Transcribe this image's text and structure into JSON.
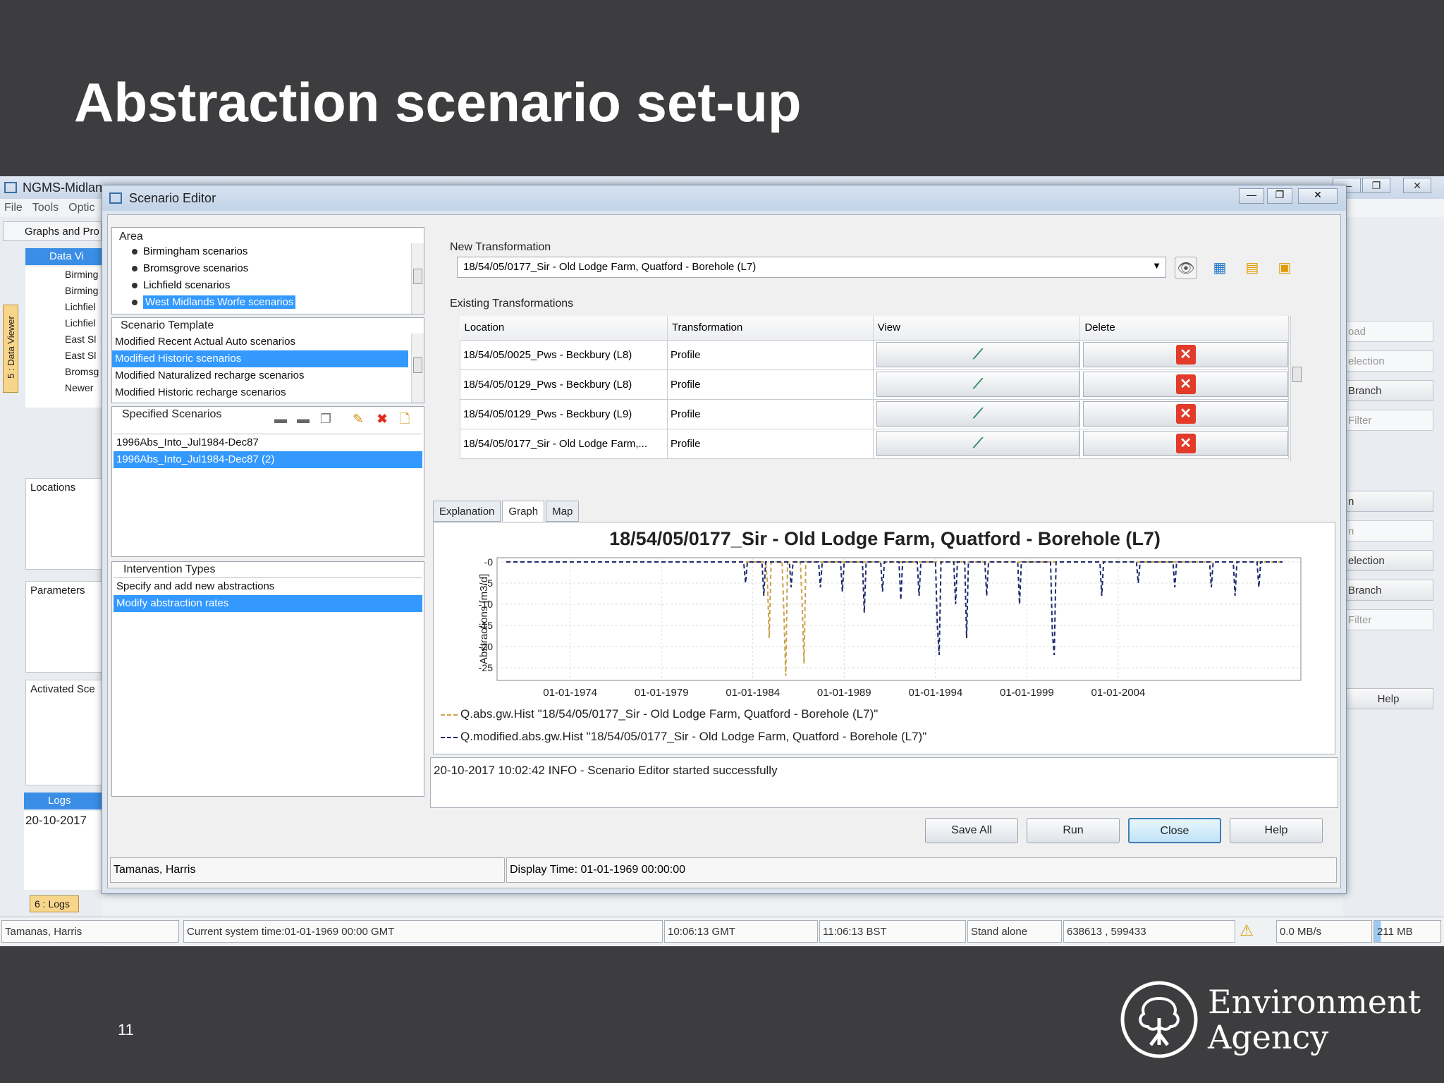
{
  "slide": {
    "title": "Abstraction scenario set-up",
    "page_number": "11",
    "logo_line1": "Environment",
    "logo_line2": "Agency"
  },
  "app": {
    "title": "NGMS-Midlan",
    "menu": [
      "File",
      "Tools",
      "Optic"
    ],
    "graphs_tab": "Graphs and Pro",
    "data_viewer_title": "Data Vi",
    "side_tab": "5 : Data Viewer",
    "tree_items": [
      "Birming",
      "Birming",
      "Lichfiel",
      "Lichfiel",
      "East Sl",
      "East Sl",
      "Bromsg",
      "Newer"
    ],
    "locations_label": "Locations",
    "parameters_label": "Parameters",
    "activated_label": "Activated Sce",
    "logs_title": "Logs",
    "logs_date": "20-10-2017",
    "logs_tab": "6 : Logs",
    "right_buttons": [
      "oad",
      "election",
      "Branch",
      "Filter",
      "n",
      "n",
      "election",
      "Branch",
      "Filter",
      "Help"
    ]
  },
  "statusbar": {
    "user": "Tamanas, Harris",
    "system_time": "Current system time:01-01-1969 00:00 GMT",
    "gmt": "10:06:13 GMT",
    "bst": "11:06:13 BST",
    "mode": "Stand alone",
    "coords": "638613 , 599433",
    "rate": "0.0 MB/s",
    "memory": "211 MB"
  },
  "dialog": {
    "title": "Scenario Editor",
    "area_label": "Area",
    "areas": [
      "Birmingham scenarios",
      "Bromsgrove scenarios",
      "Lichfield scenarios",
      "West Midlands Worfe scenarios"
    ],
    "template_label": "Scenario Template",
    "templates": [
      "Modified Recent Actual Auto scenarios",
      "Modified Historic scenarios",
      "Modified Naturalized recharge scenarios",
      "Modified Historic recharge scenarios"
    ],
    "specified_label": "Specified Scenarios",
    "specified": [
      "1996Abs_Into_Jul1984-Dec87",
      "1996Abs_Into_Jul1984-Dec87 (2)"
    ],
    "intervention_label": "Intervention Types",
    "interventions": [
      "Specify and add new abstractions",
      "Modify abstraction rates"
    ],
    "new_transformation_label": "New Transformation",
    "new_transformation_value": "18/54/05/0177_Sir - Old Lodge Farm, Quatford - Borehole (L7)",
    "existing_label": "Existing Transformations",
    "columns": [
      "Location",
      "Transformation",
      "View",
      "Delete"
    ],
    "rows": [
      {
        "location": "18/54/05/0025_Pws - Beckbury (L8)",
        "transformation": "Profile"
      },
      {
        "location": "18/54/05/0129_Pws - Beckbury (L8)",
        "transformation": "Profile"
      },
      {
        "location": "18/54/05/0129_Pws - Beckbury (L9)",
        "transformation": "Profile"
      },
      {
        "location": "18/54/05/0177_Sir - Old Lodge Farm,...",
        "transformation": "Profile"
      }
    ],
    "tabs": [
      "Explanation",
      "Graph",
      "Map"
    ],
    "log_message": "20-10-2017 10:02:42 INFO - Scenario Editor started successfully",
    "buttons": [
      "Save All",
      "Run",
      "Close",
      "Help"
    ],
    "status_user": "Tamanas, Harris",
    "status_time": "Display Time: 01-01-1969 00:00:00"
  },
  "chart_data": {
    "type": "line",
    "title": "18/54/05/0177_Sir - Old Lodge Farm, Quatford - Borehole (L7)",
    "ylabel": "Abstractions [m3/d]",
    "xlabel": "",
    "x_ticks": [
      "01-01-1974",
      "01-01-1979",
      "01-01-1984",
      "01-01-1989",
      "01-01-1994",
      "01-01-1999",
      "01-01-2004"
    ],
    "y_ticks": [
      "-0",
      "-5",
      "-10",
      "-15",
      "-20",
      "-25"
    ],
    "ylim": [
      -28,
      1
    ],
    "xlim": [
      1970,
      2014
    ],
    "grid": true,
    "colors": {
      "hist": "#c9a34a",
      "modified": "#1f2a6e"
    },
    "series": [
      {
        "name": "Q.abs.gw.Hist \"18/54/05/0177_Sir - Old Lodge Farm, Quatford - Borehole (L7)\"",
        "points": [
          [
            1970.5,
            0
          ],
          [
            1984.7,
            0
          ],
          [
            1984.8,
            -5
          ],
          [
            1984.9,
            -18
          ],
          [
            1985.0,
            0
          ],
          [
            1985.6,
            0
          ],
          [
            1985.7,
            -12
          ],
          [
            1985.8,
            -27
          ],
          [
            1985.9,
            0
          ],
          [
            1986.6,
            0
          ],
          [
            1986.7,
            -10
          ],
          [
            1986.8,
            -24
          ],
          [
            1986.9,
            0
          ],
          [
            2013.0,
            0
          ]
        ]
      },
      {
        "name": "Q.modified.abs.gw.Hist \"18/54/05/0177_Sir - Old Lodge Farm, Quatford - Borehole (L7)\"",
        "points": [
          [
            1970.5,
            0
          ],
          [
            1983.5,
            0
          ],
          [
            1983.6,
            -5
          ],
          [
            1983.7,
            0
          ],
          [
            1984.5,
            0
          ],
          [
            1984.6,
            -8
          ],
          [
            1984.7,
            0
          ],
          [
            1986.0,
            0
          ],
          [
            1986.1,
            -6
          ],
          [
            1986.2,
            0
          ],
          [
            1987.6,
            0
          ],
          [
            1987.7,
            -6
          ],
          [
            1987.8,
            0
          ],
          [
            1988.8,
            0
          ],
          [
            1988.9,
            -7
          ],
          [
            1989.0,
            0
          ],
          [
            1990.0,
            0
          ],
          [
            1990.1,
            -12
          ],
          [
            1990.2,
            0
          ],
          [
            1991.0,
            0
          ],
          [
            1991.1,
            -7
          ],
          [
            1991.2,
            0
          ],
          [
            1992.0,
            0
          ],
          [
            1992.1,
            -9
          ],
          [
            1992.2,
            0
          ],
          [
            1993.0,
            0
          ],
          [
            1993.1,
            -8
          ],
          [
            1993.2,
            0
          ],
          [
            1994.0,
            0
          ],
          [
            1994.1,
            -15
          ],
          [
            1994.2,
            -22
          ],
          [
            1994.3,
            0
          ],
          [
            1995.0,
            0
          ],
          [
            1995.1,
            -10
          ],
          [
            1995.2,
            0
          ],
          [
            1995.6,
            0
          ],
          [
            1995.7,
            -18
          ],
          [
            1995.8,
            0
          ],
          [
            1996.7,
            0
          ],
          [
            1996.8,
            -8
          ],
          [
            1996.9,
            0
          ],
          [
            1998.5,
            0
          ],
          [
            1998.6,
            -10
          ],
          [
            1998.7,
            0
          ],
          [
            2000.3,
            0
          ],
          [
            2000.4,
            -17
          ],
          [
            2000.5,
            -22
          ],
          [
            2000.6,
            0
          ],
          [
            2003.0,
            0
          ],
          [
            2003.1,
            -8
          ],
          [
            2003.2,
            0
          ],
          [
            2005.0,
            0
          ],
          [
            2005.1,
            -5
          ],
          [
            2005.2,
            0
          ],
          [
            2007.0,
            0
          ],
          [
            2007.1,
            -6
          ],
          [
            2007.2,
            0
          ],
          [
            2009.0,
            0
          ],
          [
            2009.1,
            -6
          ],
          [
            2009.2,
            0
          ],
          [
            2010.3,
            0
          ],
          [
            2010.4,
            -8
          ],
          [
            2010.5,
            0
          ],
          [
            2011.6,
            0
          ],
          [
            2011.7,
            -6
          ],
          [
            2011.8,
            0
          ],
          [
            2013.0,
            0
          ]
        ]
      }
    ]
  }
}
